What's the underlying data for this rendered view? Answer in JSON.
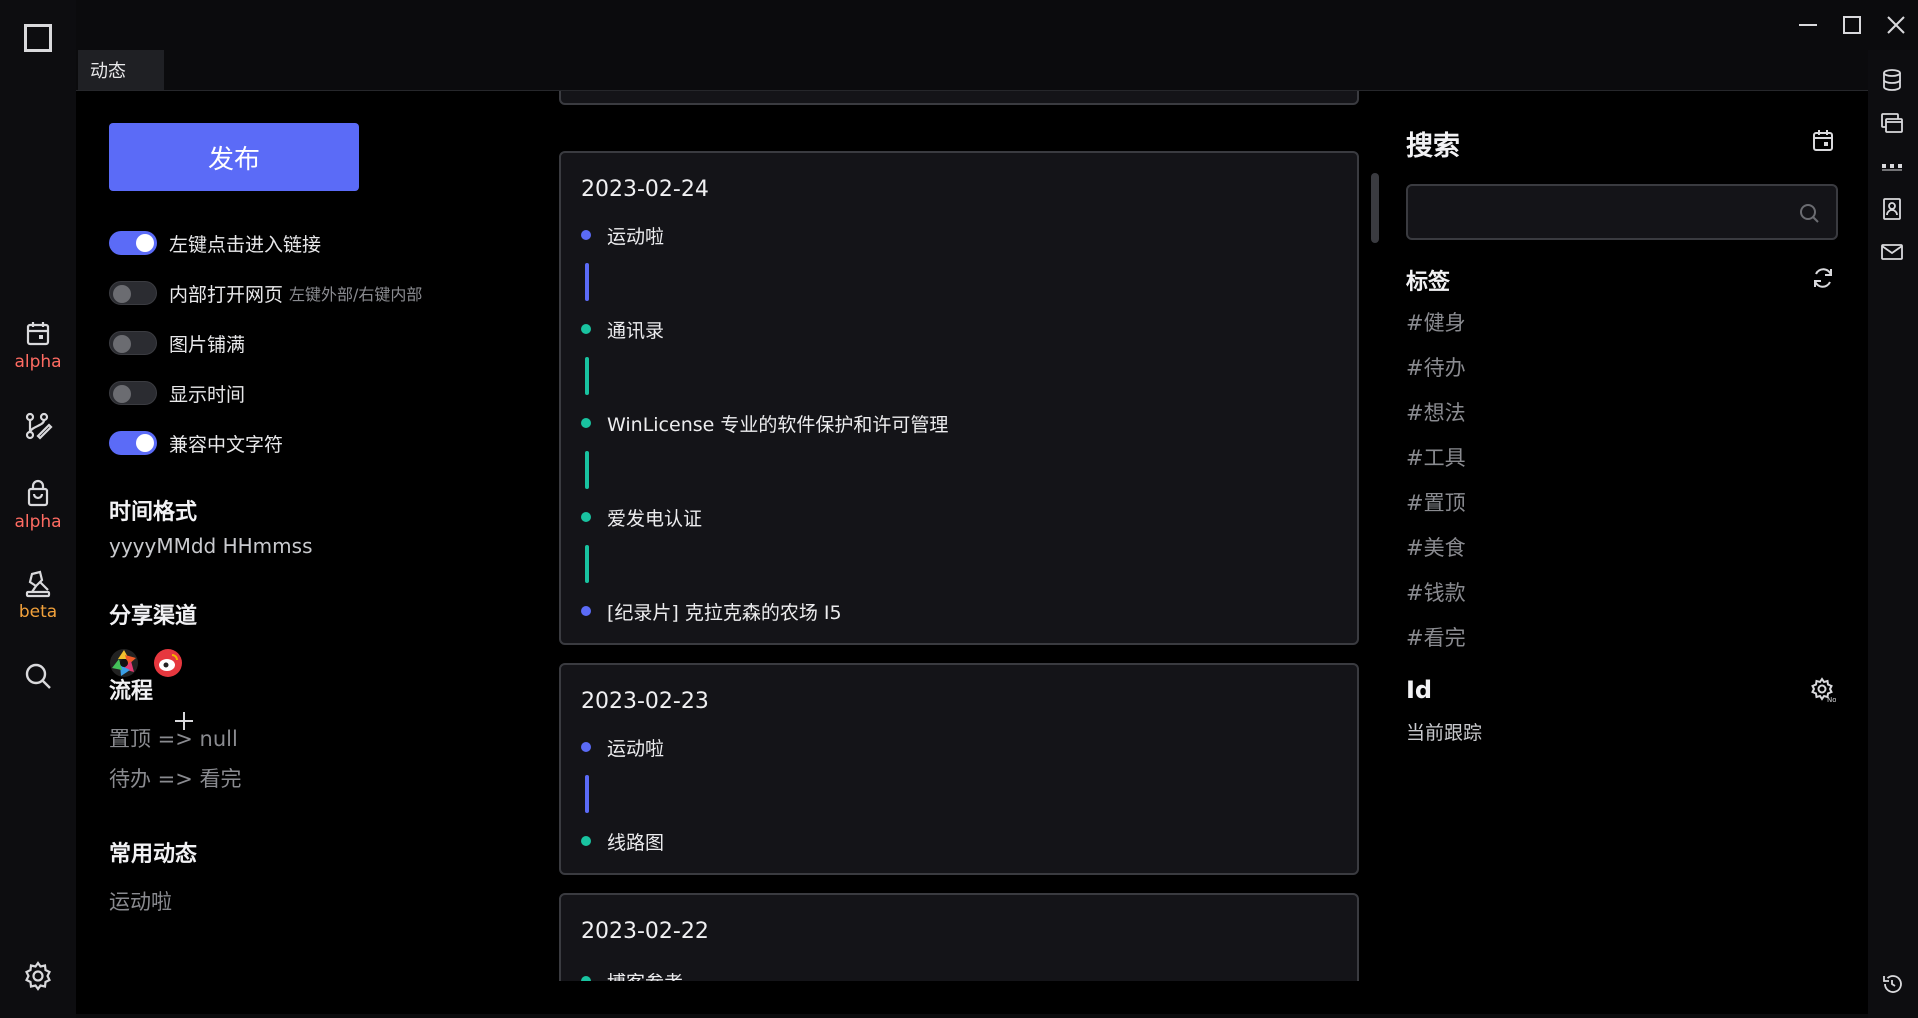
{
  "tab": {
    "label": "动态"
  },
  "left_nav": [
    {
      "name": "calendar",
      "tag": "alpha"
    },
    {
      "name": "git-branch",
      "tag": ""
    },
    {
      "name": "shopping-bag",
      "tag": "alpha"
    },
    {
      "name": "stamp",
      "tag": "beta"
    },
    {
      "name": "search",
      "tag": ""
    },
    {
      "name": "settings",
      "tag": ""
    }
  ],
  "publish_label": "发布",
  "toggles": [
    {
      "label": "左键点击进入链接",
      "hint": "",
      "on": true
    },
    {
      "label": "内部打开网页",
      "hint": "左键外部/右键内部",
      "on": false
    },
    {
      "label": "图片铺满",
      "hint": "",
      "on": false
    },
    {
      "label": "显示时间",
      "hint": "",
      "on": false
    },
    {
      "label": "兼容中文字符",
      "hint": "",
      "on": true
    }
  ],
  "time_format": {
    "title": "时间格式",
    "value": "yyyyMMdd HHmmss"
  },
  "share": {
    "title": "分享渠道"
  },
  "flow": {
    "title": "流程",
    "items": [
      "置顶 => null",
      "待办 => 看完"
    ]
  },
  "common": {
    "title": "常用动态",
    "items": [
      "运动啦"
    ]
  },
  "feed": [
    {
      "date": "2023-02-24",
      "events": [
        {
          "text": "运动啦",
          "color": "#5b6bf7"
        },
        {
          "text": "通讯录",
          "color": "#19c3a0"
        },
        {
          "text": "WinLicense 专业的软件保护和许可管理",
          "color": "#19c3a0"
        },
        {
          "text": "爱发电认证",
          "color": "#19c3a0"
        },
        {
          "text": "[纪录片] 克拉克森的农场 I5",
          "color": "#5b6bf7"
        }
      ]
    },
    {
      "date": "2023-02-23",
      "events": [
        {
          "text": "运动啦",
          "color": "#5b6bf7"
        },
        {
          "text": "线路图",
          "color": "#19c3a0"
        }
      ]
    },
    {
      "date": "2023-02-22",
      "events": [
        {
          "text": "博客参考",
          "color": "#19c3a0"
        }
      ]
    }
  ],
  "search": {
    "title": "搜索",
    "placeholder": ""
  },
  "tags": {
    "title": "标签",
    "items": [
      "#健身",
      "#待办",
      "#想法",
      "#工具",
      "#置顶",
      "#美食",
      "#钱款",
      "#看完"
    ]
  },
  "id_section": {
    "title": "Id",
    "value": "当前跟踪"
  },
  "colors": {
    "accent": "#5b6bf7",
    "teal": "#19c3a0",
    "alpha": "#ff6b62",
    "beta": "#f2a13b"
  }
}
